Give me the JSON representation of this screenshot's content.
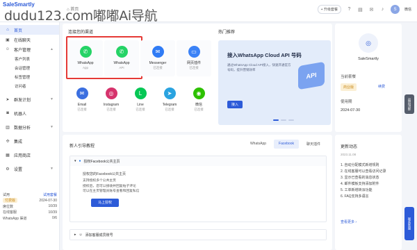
{
  "brand": {
    "logo": "SaleSmartly",
    "watermark": "dudu123.com嘟嘟Ai导航"
  },
  "breadcrumb": "首页",
  "topbar": {
    "sales_pill": "+ 升级套餐",
    "user": "微信"
  },
  "sidebar": {
    "items": [
      {
        "label": "首页",
        "icon": "home-icon"
      },
      {
        "label": "在线聊天",
        "icon": "chat-icon"
      },
      {
        "label": "客户管理",
        "icon": "users-icon"
      }
    ],
    "sub_items": [
      "客户列表",
      "会话管理",
      "标签管理",
      "访问者"
    ],
    "more_items": [
      {
        "label": "群发计划",
        "icon": "send-icon"
      },
      {
        "label": "机器人",
        "icon": "robot-icon"
      },
      {
        "label": "数据分析",
        "icon": "chart-icon"
      },
      {
        "label": "集成",
        "icon": "plugin-icon"
      },
      {
        "label": "应用商店",
        "icon": "store-icon"
      },
      {
        "label": "设置",
        "icon": "gear-icon"
      }
    ]
  },
  "plan": {
    "title": "试用",
    "trial": "试用套餐",
    "rows": [
      {
        "k": "付费版",
        "v": "2024-07-30"
      },
      {
        "k": "席位数",
        "v": "10/39"
      },
      {
        "k": "在线客服",
        "v": "10/39"
      },
      {
        "k": "WhatsApp 渠道",
        "v": "0/6"
      }
    ]
  },
  "channels": {
    "title": "连接您的渠道",
    "items": [
      {
        "name": "WhatsApp",
        "sub": "App",
        "color": "#25d366",
        "glyph": "✆"
      },
      {
        "name": "WhatsApp",
        "sub": "API",
        "color": "#25d366",
        "glyph": "✆"
      },
      {
        "name": "Messenger",
        "sub": "已连接",
        "color": "#2f7bf5",
        "glyph": "✉"
      },
      {
        "name": "网页插件",
        "sub": "已连接",
        "color": "#3b82f6",
        "glyph": "▭"
      },
      {
        "name": "Email",
        "sub": "已连接",
        "color": "#3b6fe0",
        "glyph": "✉"
      },
      {
        "name": "Instagram",
        "sub": "已连接",
        "color": "#d6336c",
        "glyph": "◎"
      },
      {
        "name": "Line",
        "sub": "已连接",
        "color": "#06c755",
        "glyph": "L"
      },
      {
        "name": "Telegram",
        "sub": "已连接",
        "color": "#2aa3e0",
        "glyph": "➤"
      },
      {
        "name": "微信",
        "sub": "已连接",
        "color": "#2dc100",
        "glyph": "◉"
      }
    ]
  },
  "promo": {
    "section": "热门推荐",
    "title": "接入WhatsApp Cloud API 号码",
    "desc": "通过WhatsApp Cloud API接入，快速开通官方号码，提升营销效率",
    "button": "接入",
    "art": "API"
  },
  "tutorial": {
    "title": "新人引导教程",
    "tabs": [
      "WhatsApp",
      "Facebook",
      "聊天插件"
    ],
    "active_tab": "Facebook",
    "acc1": {
      "title": "授权Facebook公共主页",
      "intro": "授权您的Facebook公共主页",
      "bullets": [
        "支持授权多个公共主页",
        "授权后，您可以接收并回复帖子评论",
        "可以在主页管理员账号查看和回复私信"
      ],
      "button": "马上授权"
    },
    "acc2": {
      "title": "添加客服成员账号"
    }
  },
  "profile": {
    "name": "SaleSmartly"
  },
  "plan_card": {
    "label": "当前套餐",
    "badge": "商业版",
    "renew": "续费",
    "expire_label": "使用期",
    "expire": "2024-07-30"
  },
  "news": {
    "title": "更新动态",
    "date": "2023.11.08",
    "items": [
      "1. 自动分配模式新增规则",
      "2. 在线客服可以查看访问记录",
      "3. 显示已查看的消息状态",
      "4. 邮件模板支持添加附件",
      "5. 工单新增转派功能",
      "6. FAQ支持多语言"
    ],
    "more": "查看更多 ›"
  },
  "float": {
    "top": "返回顶部",
    "bottom": "联系客服"
  }
}
